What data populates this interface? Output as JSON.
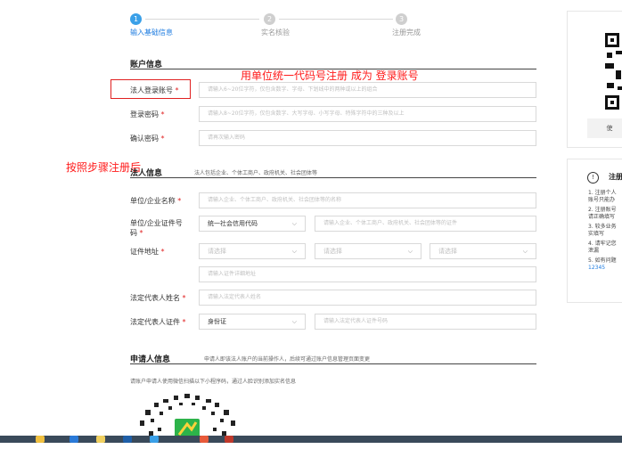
{
  "steps": [
    {
      "num": "1",
      "label": "输入基础信息",
      "active": true
    },
    {
      "num": "2",
      "label": "实名核验",
      "active": false
    },
    {
      "num": "3",
      "label": "注册完成",
      "active": false
    }
  ],
  "account": {
    "title": "账户信息",
    "fields": [
      {
        "label": "法人登录账号",
        "placeholder": "请输入6~20位字符，仅包含数字、字母、下划线中的两种或以上的组合"
      },
      {
        "label": "登录密码",
        "placeholder": "请输入8~20位字符，仅包含数字、大写字母、小写字母、特殊字符中的三种及以上"
      },
      {
        "label": "确认密码",
        "placeholder": "请再次输入密码"
      }
    ]
  },
  "legal": {
    "title": "法人信息",
    "hint": "法人包括企业、个体工商户、政府机关、社会团体等",
    "unit_name": {
      "label": "单位/企业名称",
      "placeholder": "请输入企业、个体工商户、政府机关、社会团体等的名称"
    },
    "cert_no": {
      "label_line1": "单位/企业证件号",
      "label_line2": "码",
      "select": "统一社会信用代码",
      "placeholder": "请输入企业、个体工商户、政府机关、社会团体等的证件"
    },
    "address": {
      "label": "证件地址",
      "sel1": "请选择",
      "sel2": "请选择",
      "sel3": "请选择",
      "detail_placeholder": "请输入证件详细地址"
    },
    "rep_name": {
      "label": "法定代表人姓名",
      "placeholder": "请输入法定代表人姓名"
    },
    "rep_cert": {
      "label": "法定代表人证件",
      "select": "身份证",
      "placeholder": "请输入法定代表人证件号码"
    }
  },
  "applicant": {
    "title": "申请人信息",
    "hint": "申请人即该法人账户的当前操作人，后续可通过账户信息管理页面变更",
    "desc": "请账户申请人使用微信扫描以下小程序码，通过人脸识别添加实名信息"
  },
  "annotations": {
    "top": "用单位统一代码号注册 成为 登录账号",
    "left": "按照步骤注册后"
  },
  "right_panel": {
    "qr_button": "使",
    "notes_title": "注册",
    "notes": [
      "1. 注册个人",
      "账号只能办",
      "2. 注册账号",
      "请正确填写",
      "3. 较多业务",
      "实填写",
      "4. 请牢记您",
      "泄漏",
      "5. 如有问题",
      "12345"
    ]
  },
  "colors": {
    "primary": "#1e7ce0",
    "accent": "#3aa0e8",
    "inactive": "#cfcfcf",
    "annotation": "#ff1a1a"
  }
}
